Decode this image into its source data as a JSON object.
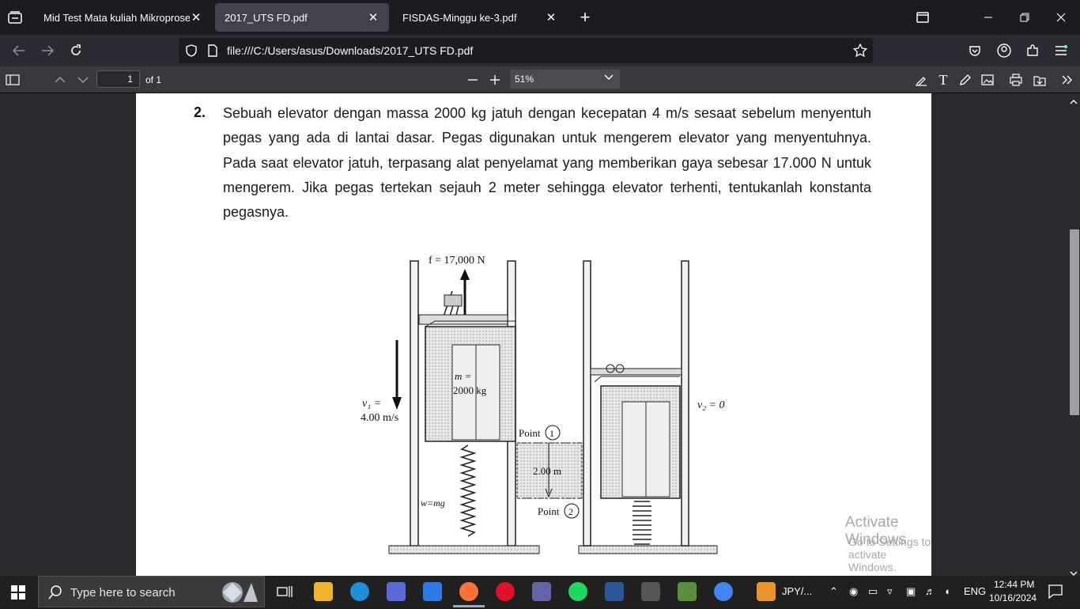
{
  "tabs": [
    {
      "label": "Mid Test Mata kuliah Mikroprosesor",
      "active": false
    },
    {
      "label": "2017_UTS FD.pdf",
      "active": true
    },
    {
      "label": "FISDAS-Minggu ke-3.pdf",
      "active": false
    }
  ],
  "nav": {
    "url": "file:///C:/Users/asus/Downloads/2017_UTS FD.pdf"
  },
  "pdf_toolbar": {
    "page_number": "1",
    "page_count_label": "of 1",
    "zoom": "51%"
  },
  "document": {
    "question_number": "2.",
    "question_lines": [
      "Sebuah elevator dengan massa 2000 kg jatuh dengan kecepatan 4 m/s sesaat sebelum menyentuh",
      "pegas yang ada di lantai dasar. Pegas digunakan untuk mengerem elevator yang menyentuhnya.",
      "Pada saat elevator jatuh, terpasang alat penyelamat yang memberikan gaya sebesar 17.000 N untuk",
      "mengerem. Jika pegas tertekan sejauh 2 meter sehingga elevator terhenti, tentukanlah konstanta",
      "pegasnya."
    ],
    "figure": {
      "force_label": "f = 17,000 N",
      "mass_label_1": "m =",
      "mass_label_2": "2000 kg",
      "v1_label_1": "v₁ =",
      "v1_label_2": "4.00 m/s",
      "v2_label": "v₂ = 0",
      "point1": "Point",
      "point1_num": "1",
      "point2": "Point",
      "point2_num": "2",
      "distance": "2.00 m",
      "weight_label": "w=mg"
    }
  },
  "watermark": {
    "line1": "Activate Windows",
    "line2": "Go to Settings to activate Windows."
  },
  "taskbar": {
    "search_placeholder": "Type here to search",
    "currency": "JPY/...",
    "language": "ENG",
    "time": "12:44 PM",
    "date": "10/16/2024"
  }
}
